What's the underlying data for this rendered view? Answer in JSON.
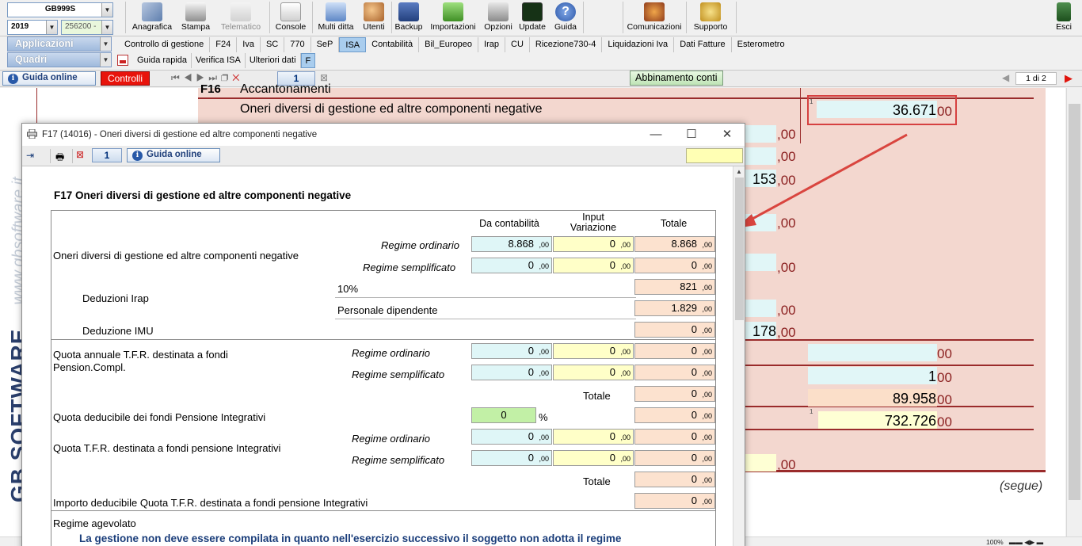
{
  "topbar": {
    "company_combo": "GB999S",
    "year_combo": "2019",
    "code_combo": "256200 -",
    "buttons": [
      {
        "label": "Anagrafica",
        "enabled": true
      },
      {
        "label": "Stampa",
        "enabled": true
      },
      {
        "label": "Telematico",
        "enabled": false
      },
      {
        "label": "Console",
        "enabled": true
      },
      {
        "label": "Multi ditta",
        "enabled": true
      },
      {
        "label": "Utenti",
        "enabled": true
      },
      {
        "label": "Backup",
        "enabled": true
      },
      {
        "label": "Importazioni",
        "enabled": true
      },
      {
        "label": "Opzioni",
        "enabled": true
      },
      {
        "label": "Update",
        "enabled": true
      },
      {
        "label": "Guida",
        "enabled": true
      },
      {
        "label": "Comunicazioni",
        "enabled": true
      },
      {
        "label": "Supporto",
        "enabled": true
      },
      {
        "label": "Esci",
        "enabled": true
      }
    ]
  },
  "nav": {
    "applicazioni_label": "Applicazioni",
    "quadri_label": "Quadri",
    "tabs": [
      "Controllo di gestione",
      "F24",
      "Iva",
      "SC",
      "770",
      "SeP",
      "ISA",
      "Contabilità",
      "Bil_Europeo",
      "Irap",
      "CU",
      "Ricezione730-4",
      "Liquidazioni Iva",
      "Dati Fatture",
      "Esterometro"
    ],
    "active_tab": "ISA",
    "subtabs": [
      "Guida rapida",
      "Verifica ISA",
      "Ulteriori dati",
      "F"
    ],
    "active_subtab": "F"
  },
  "toolbar2": {
    "guide_label": "Guida online",
    "controls_label": "Controlli",
    "page_number": "1",
    "match_label": "Abbinamento conti",
    "page_indicator": "1 di 2"
  },
  "background_form": {
    "row_f16_label": "Accantonamenti",
    "row_f16_code": "F16",
    "row_f17_label": "Oneri diversi di gestione ed altre componenti negative",
    "f17_value": "36.671",
    "dec": ",00",
    "dec2": "00",
    "values_left": [
      "153",
      "178"
    ],
    "values_right": [
      "1",
      "89.958",
      "732.726"
    ],
    "segue": "(segue)",
    "zoom": "100%"
  },
  "dialog": {
    "title": "F17 (14016) - Oneri diversi di gestione ed altre componenti negative",
    "tool_page_number": "1",
    "tool_guide_label": "Guida online",
    "heading": "F17 Oneri diversi di gestione ed altre componenti negative",
    "col_headers": {
      "contabilita": "Da contabilità",
      "input": "Input Variazione",
      "totale": "Totale"
    },
    "dec": ",00",
    "regime_ordinario": "Regime ordinario",
    "regime_semplificato": "Regime semplificato",
    "totale_label": "Totale",
    "oneri": {
      "label": "Oneri diversi di gestione ed altre componenti negative",
      "ord_cont": "8.868",
      "ord_input": "0",
      "ord_tot": "8.868",
      "sem_cont": "0",
      "sem_input": "0",
      "sem_tot": "0"
    },
    "deduzioni_irap": {
      "label": "Deduzioni Irap",
      "pct_label": "10%",
      "pct_value": "821",
      "pers_label": "Personale dipendente",
      "pers_value": "1.829"
    },
    "deduzione_imu": {
      "label": "Deduzione IMU",
      "value": "0"
    },
    "quota_tfr": {
      "label": "Quota annuale T.F.R. destinata a fondi Pension.Compl.",
      "ord_cont": "0",
      "ord_input": "0",
      "ord_tot": "0",
      "sem_cont": "0",
      "sem_input": "0",
      "sem_tot": "0",
      "totale": "0"
    },
    "quota_deducibile": {
      "label": "Quota deducibile dei fondi Pensione Integrativi",
      "pct": "0",
      "pct_sign": "%",
      "value": "0"
    },
    "quota_tfr_int": {
      "label": "Quota T.F.R. destinata a fondi pensione Integrativi",
      "ord_cont": "0",
      "ord_input": "0",
      "ord_tot": "0",
      "sem_cont": "0",
      "sem_input": "0",
      "sem_tot": "0",
      "totale": "0"
    },
    "importo_deducibile": {
      "label": "Importo deducibile Quota T.F.R. destinata a fondi pensione Integrativi",
      "value": "0"
    },
    "regime_agevolato": "Regime agevolato",
    "note": "La gestione non deve essere compilata in quanto nell'esercizio successivo il soggetto non adotta il regime"
  }
}
